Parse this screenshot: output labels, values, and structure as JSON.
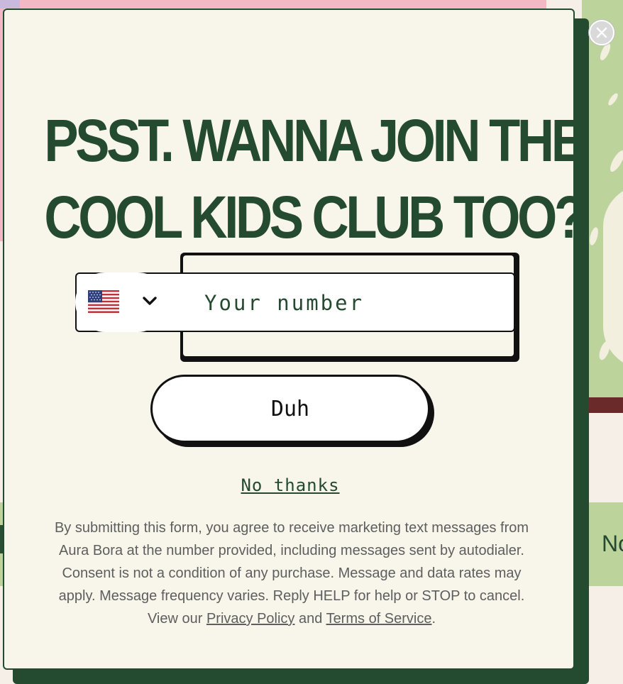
{
  "popup": {
    "headline_line1": "PSST. WANNA JOIN THE",
    "headline_line2": "COOL KIDS CLUB TOO?",
    "phone": {
      "country": "US",
      "placeholder": "Your number",
      "value": ""
    },
    "submit_label": "Duh",
    "decline_label": "No thanks",
    "disclaimer": {
      "text": "By submitting this form, you agree to receive marketing text messages from Aura Bora at the number provided, including messages sent by autodialer. Consent is not a condition of any purchase. Message and data rates may apply. Message frequency varies. Reply HELP for help or STOP to cancel. View our ",
      "privacy_link": "Privacy Policy",
      "and": " and ",
      "terms_link": "Terms of Service",
      "end": "."
    },
    "close_icon": "close-icon"
  },
  "background": {
    "partial_text": "No"
  },
  "colors": {
    "brand_green": "#244a30",
    "cream": "#f8f5ea",
    "sage": "#bcd39c",
    "pink": "#f2b8c4"
  }
}
